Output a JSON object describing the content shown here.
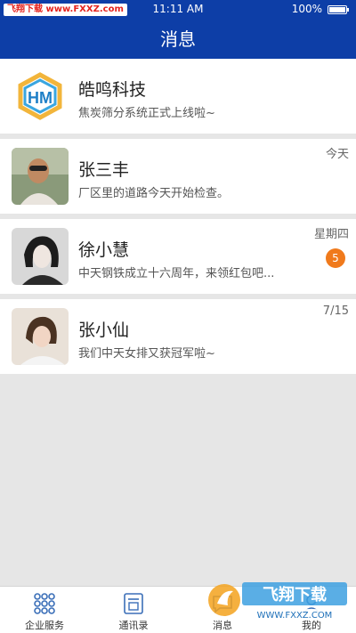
{
  "status_bar": {
    "watermark": "飞翔下载 www.FXXZ.com",
    "time": "11:11 AM",
    "battery": "100%"
  },
  "header": {
    "title": "消息"
  },
  "conversations": [
    {
      "name": "皓鸣科技",
      "message": "焦炭筛分系统正式上线啦~",
      "date": "",
      "badge": "",
      "avatar_icon": "hm-logo-icon"
    },
    {
      "name": "张三丰",
      "message": "厂区里的道路今天开始检查。",
      "date": "今天",
      "badge": "",
      "avatar_icon": "man-avatar"
    },
    {
      "name": "徐小慧",
      "message": "中天钢铁成立十六周年，来领红包吧...",
      "date": "星期四",
      "badge": "5",
      "avatar_icon": "woman-avatar"
    },
    {
      "name": "张小仙",
      "message": "我们中天女排又获冠军啦~",
      "date": "7/15",
      "badge": "",
      "avatar_icon": "woman-avatar"
    }
  ],
  "tabs": [
    {
      "label": "企业服务",
      "icon": "grid-icon"
    },
    {
      "label": "通讯录",
      "icon": "contacts-icon"
    },
    {
      "label": "消息",
      "icon": "message-icon"
    },
    {
      "label": "我的",
      "icon": "profile-icon"
    }
  ],
  "promo": {
    "text": "飞翔下载",
    "url_text": "WWW.FXXZ.COM"
  },
  "colors": {
    "primary": "#0d3ea7",
    "badge": "#f07a1c",
    "background": "#e6e6e6"
  }
}
